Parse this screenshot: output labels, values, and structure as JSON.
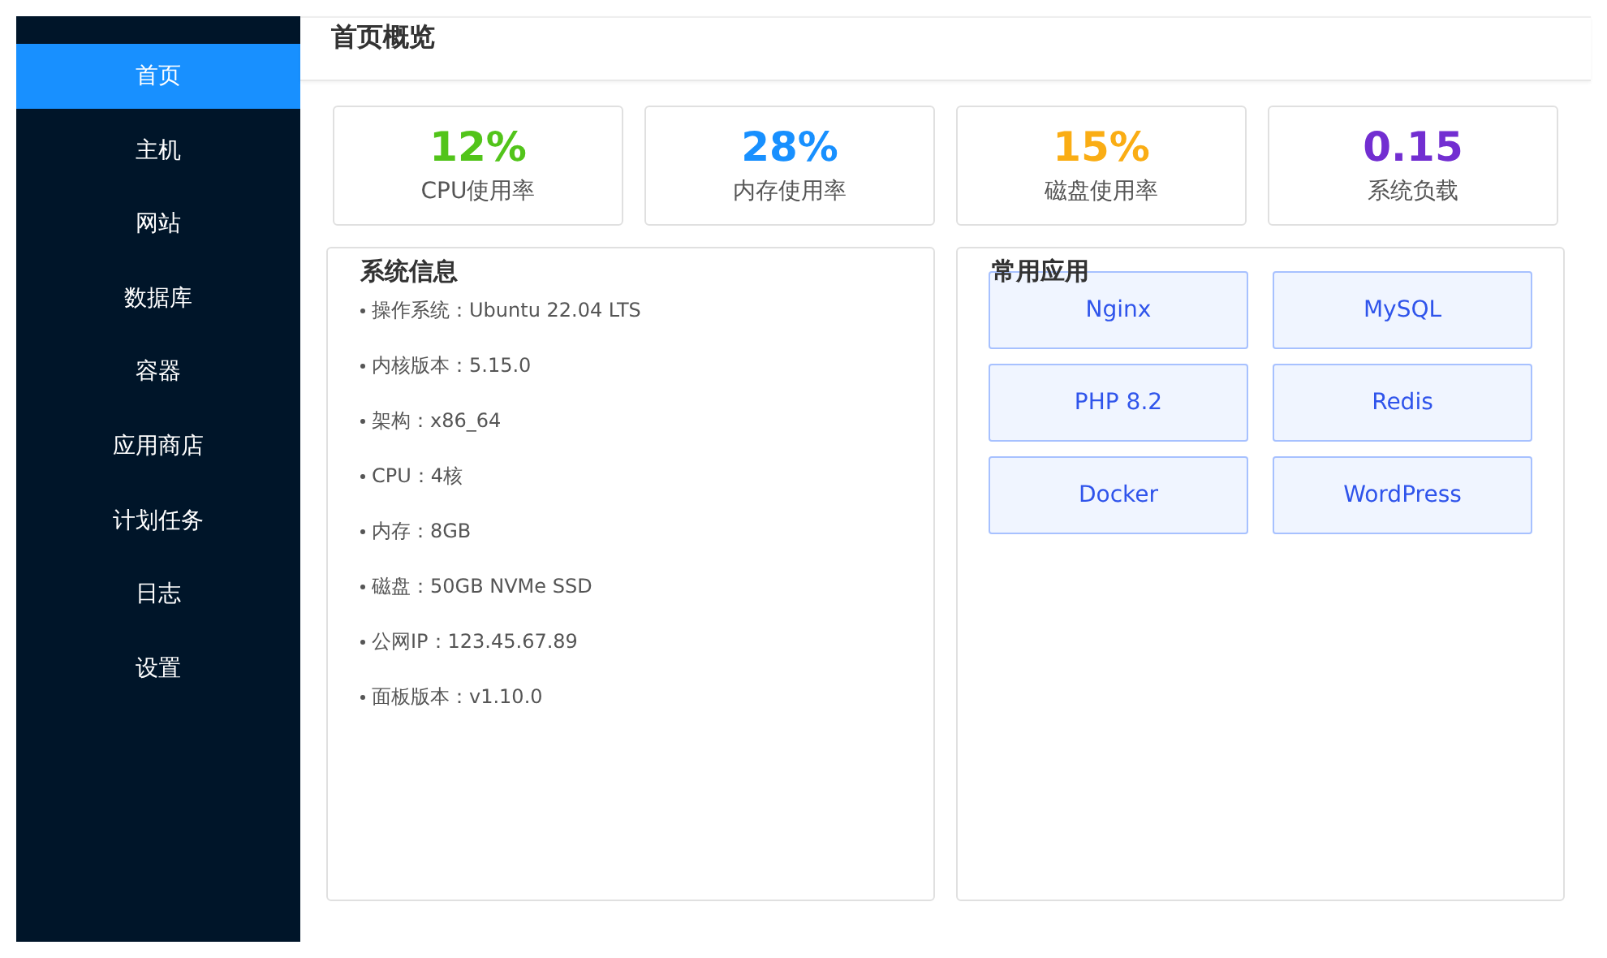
{
  "sidebar": {
    "items": [
      {
        "label": "首页",
        "selected": true
      },
      {
        "label": "主机",
        "selected": false
      },
      {
        "label": "网站",
        "selected": false
      },
      {
        "label": "数据库",
        "selected": false
      },
      {
        "label": "容器",
        "selected": false
      },
      {
        "label": "应用商店",
        "selected": false
      },
      {
        "label": "计划任务",
        "selected": false
      },
      {
        "label": "日志",
        "selected": false
      },
      {
        "label": "设置",
        "selected": false
      }
    ]
  },
  "header": {
    "title": "首页概览"
  },
  "stats": [
    {
      "value": "12%",
      "label": "CPU使用率",
      "color": "#52c41a"
    },
    {
      "value": "28%",
      "label": "内存使用率",
      "color": "#1890ff"
    },
    {
      "value": "15%",
      "label": "磁盘使用率",
      "color": "#faad14"
    },
    {
      "value": "0.15",
      "label": "系统负载",
      "color": "#722ed1"
    }
  ],
  "system_info": {
    "title": "系统信息",
    "items": [
      "操作系统：Ubuntu 22.04 LTS",
      "内核版本：5.15.0",
      "架构：x86_64",
      "CPU：4核",
      "内存：8GB",
      "磁盘：50GB NVMe SSD",
      "公网IP：123.45.67.89",
      "面板版本：v1.10.0"
    ]
  },
  "apps": {
    "title": "常用应用",
    "items": [
      "Nginx",
      "MySQL",
      "PHP 8.2",
      "Redis",
      "Docker",
      "WordPress"
    ]
  }
}
